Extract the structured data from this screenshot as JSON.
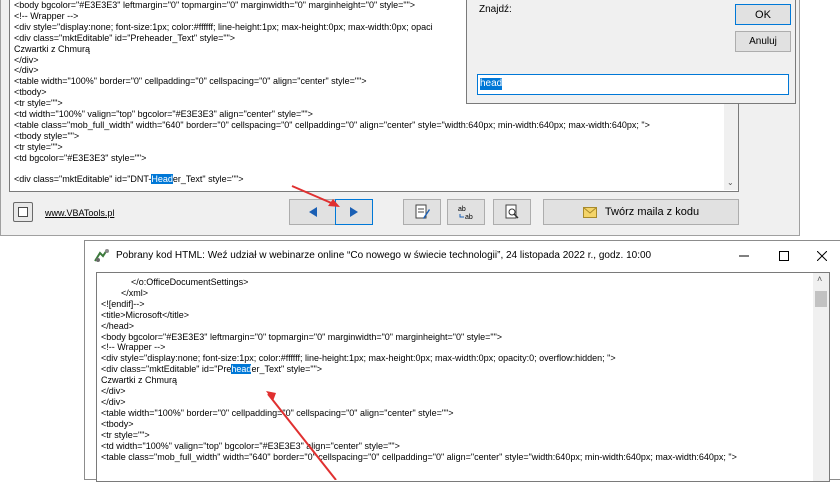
{
  "top_window": {
    "code_lines": [
      "<body bgcolor=\"#E3E3E3\" leftmargin=\"0\" topmargin=\"0\" marginwidth=\"0\" marginheight=\"0\" style=\"\">",
      "<!-- Wrapper -->",
      "<div style=\"display:none; font-size:1px; color:#ffffff; line-height:1px; max-height:0px; max-width:0px; opaci",
      "<div class=\"mktEditable\" id=\"Preheader_Text\" style=\"\">",
      "Czwartki z Chmurą",
      "</div>",
      "</div>",
      "<table width=\"100%\" border=\"0\" cellpadding=\"0\" cellspacing=\"0\" align=\"center\" style=\"\">",
      "<tbody>",
      "<tr style=\"\">",
      "<td width=\"100%\" valign=\"top\" bgcolor=\"#E3E3E3\" align=\"center\" style=\"\">",
      "<table class=\"mob_full_width\" width=\"640\" border=\"0\" cellspacing=\"0\" cellpadding=\"0\" align=\"center\" style=\"width:640px; min-width:640px; max-width:640px; \">",
      "<tbody style=\"\">",
      "<tr style=\"\">",
      "<td bgcolor=\"#E3E3E3\" style=\"\">"
    ],
    "last_line": {
      "before": "<div class=\"mktEditable\" id=\"DNT-",
      "match": "Head",
      "after": "er_Text\" style=\"\">"
    },
    "footer": {
      "link": "www.VBATools.pl",
      "prev_icon": "triangle-left-icon",
      "next_icon": "triangle-right-icon",
      "create_mail_label": "Twórz maila z kodu"
    }
  },
  "find_dialog": {
    "label": "Znajdź:",
    "ok_label": "OK",
    "cancel_label": "Anuluj",
    "search_value": "head"
  },
  "bottom_window": {
    "title": "Pobrany kod HTML: Weź udział w webinarze online “Co nowego w świecie technologii”, 24 listopada 2022 r., godz. 10:00",
    "code_lines": [
      "            </o:OfficeDocumentSettings>",
      "        </xml>",
      "<![endif]-->",
      "<title>Microsoft</title>",
      "</head>",
      "<body bgcolor=\"#E3E3E3\" leftmargin=\"0\" topmargin=\"0\" marginwidth=\"0\" marginheight=\"0\" style=\"\">",
      "<!-- Wrapper -->",
      "<div style=\"display:none; font-size:1px; color:#ffffff; line-height:1px; max-height:0px; max-width:0px; opacity:0; overflow:hidden; \">"
    ],
    "highlight_line": {
      "before": "<div class=\"mktEditable\" id=\"Pre",
      "match": "head",
      "after": "er_Text\" style=\"\">"
    },
    "code_lines_after": [
      "Czwartki z Chmurą",
      "</div>",
      "</div>",
      "<table width=\"100%\" border=\"0\" cellpadding=\"0\" cellspacing=\"0\" align=\"center\" style=\"\">",
      "<tbody>",
      "<tr style=\"\">",
      "<td width=\"100%\" valign=\"top\" bgcolor=\"#E3E3E3\" align=\"center\" style=\"\">",
      "<table class=\"mob_full_width\" width=\"640\" border=\"0\" cellspacing=\"0\" cellpadding=\"0\" align=\"center\" style=\"width:640px; min-width:640px; max-width:640px; \">"
    ]
  },
  "colors": {
    "selection": "#0078d7",
    "arrow": "#e03030",
    "accent_nav": "#1a5fb4"
  }
}
